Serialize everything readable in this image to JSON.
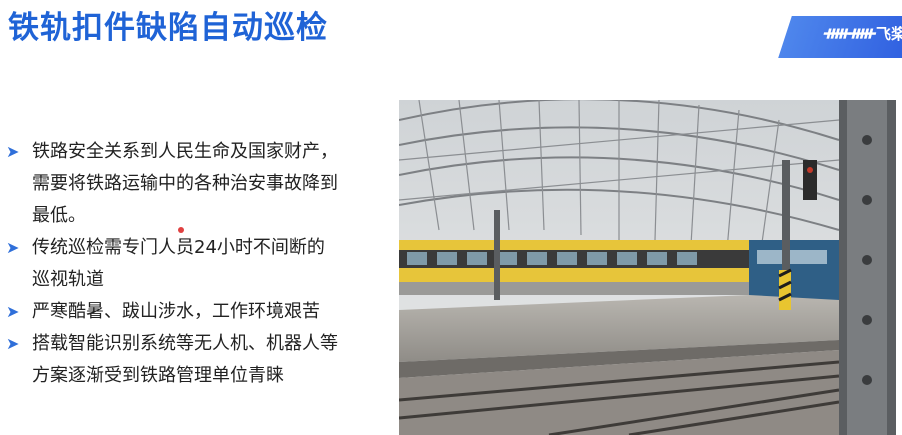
{
  "slide": {
    "title": "铁轨扣件缺陷自动巡检",
    "logo": {
      "mark": "ᚔᚔ",
      "text": "飞桨"
    },
    "bullets": [
      {
        "lines": [
          "铁路安全关系到人民生命及国家财产，",
          "需要将铁路运输中的各种治安事故降到",
          "最低。"
        ]
      },
      {
        "lines": [
          "传统巡检需专门人员24小时不间断的",
          "巡视轨道"
        ]
      },
      {
        "lines": [
          "严寒酷暑、跋山涉水，工作环境艰苦"
        ]
      },
      {
        "lines": [
          "搭载智能识别系统等无人机、机器人等",
          "方案逐渐受到铁路管理单位青睐"
        ]
      }
    ],
    "bullet_icon": "arrow-bullet-icon",
    "colors": {
      "title": "#1f63d6",
      "accent": "#2f6fd9",
      "train_yellow": "#e7c53a"
    }
  }
}
